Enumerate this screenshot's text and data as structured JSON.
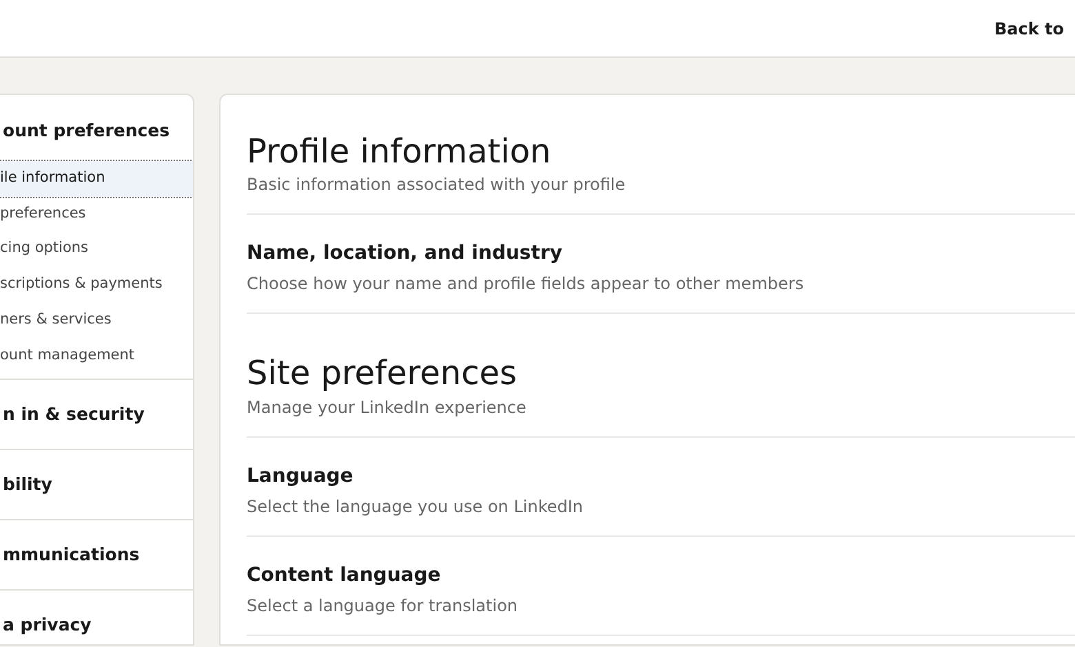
{
  "header": {
    "link": "Back to"
  },
  "sidebar": {
    "groups": [
      {
        "title": "ount preferences",
        "items": [
          {
            "label": "ile information",
            "selected": true
          },
          {
            "label": "preferences",
            "selected": false
          },
          {
            "label": "cing options",
            "selected": false
          },
          {
            "label": "scriptions & payments",
            "selected": false
          },
          {
            "label": "ners & services",
            "selected": false
          },
          {
            "label": "ount management",
            "selected": false
          }
        ]
      },
      {
        "title": "n in & security"
      },
      {
        "title": "bility"
      },
      {
        "title": "mmunications"
      },
      {
        "title": "a privacy"
      }
    ]
  },
  "sections": [
    {
      "title": "Profile information",
      "subtitle": "Basic information associated with your profile",
      "settings": [
        {
          "title": "Name, location, and industry",
          "description": "Choose how your name and profile fields appear to other members"
        }
      ]
    },
    {
      "title": "Site preferences",
      "subtitle": "Manage your LinkedIn experience",
      "settings": [
        {
          "title": "Language",
          "description": "Select the language you use on LinkedIn"
        },
        {
          "title": "Content language",
          "description": "Select a language for translation"
        }
      ]
    }
  ]
}
